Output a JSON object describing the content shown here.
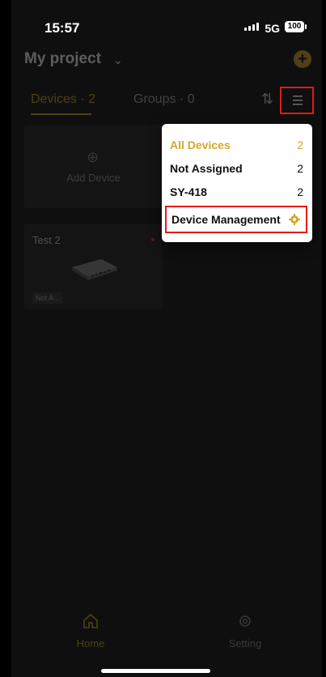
{
  "status": {
    "time": "15:57",
    "network": "5G",
    "battery": "100"
  },
  "header": {
    "project_title": "My project",
    "add_icon": "plus-circle-icon"
  },
  "tabs": {
    "devices": "Devices · 2",
    "groups": "Groups · 0"
  },
  "cards": {
    "add_device": "Add Device",
    "device_name": "Test 2",
    "device_tag": "Not A..."
  },
  "dropdown": {
    "items": [
      {
        "label": "All Devices",
        "count": "2"
      },
      {
        "label": "Not Assigned",
        "count": "2"
      },
      {
        "label": "SY-418",
        "count": "2"
      }
    ],
    "manage_label": "Device Management"
  },
  "bottom_nav": {
    "home": "Home",
    "setting": "Setting"
  },
  "colors": {
    "accent": "#d9a528",
    "highlight": "#e31b1b"
  }
}
